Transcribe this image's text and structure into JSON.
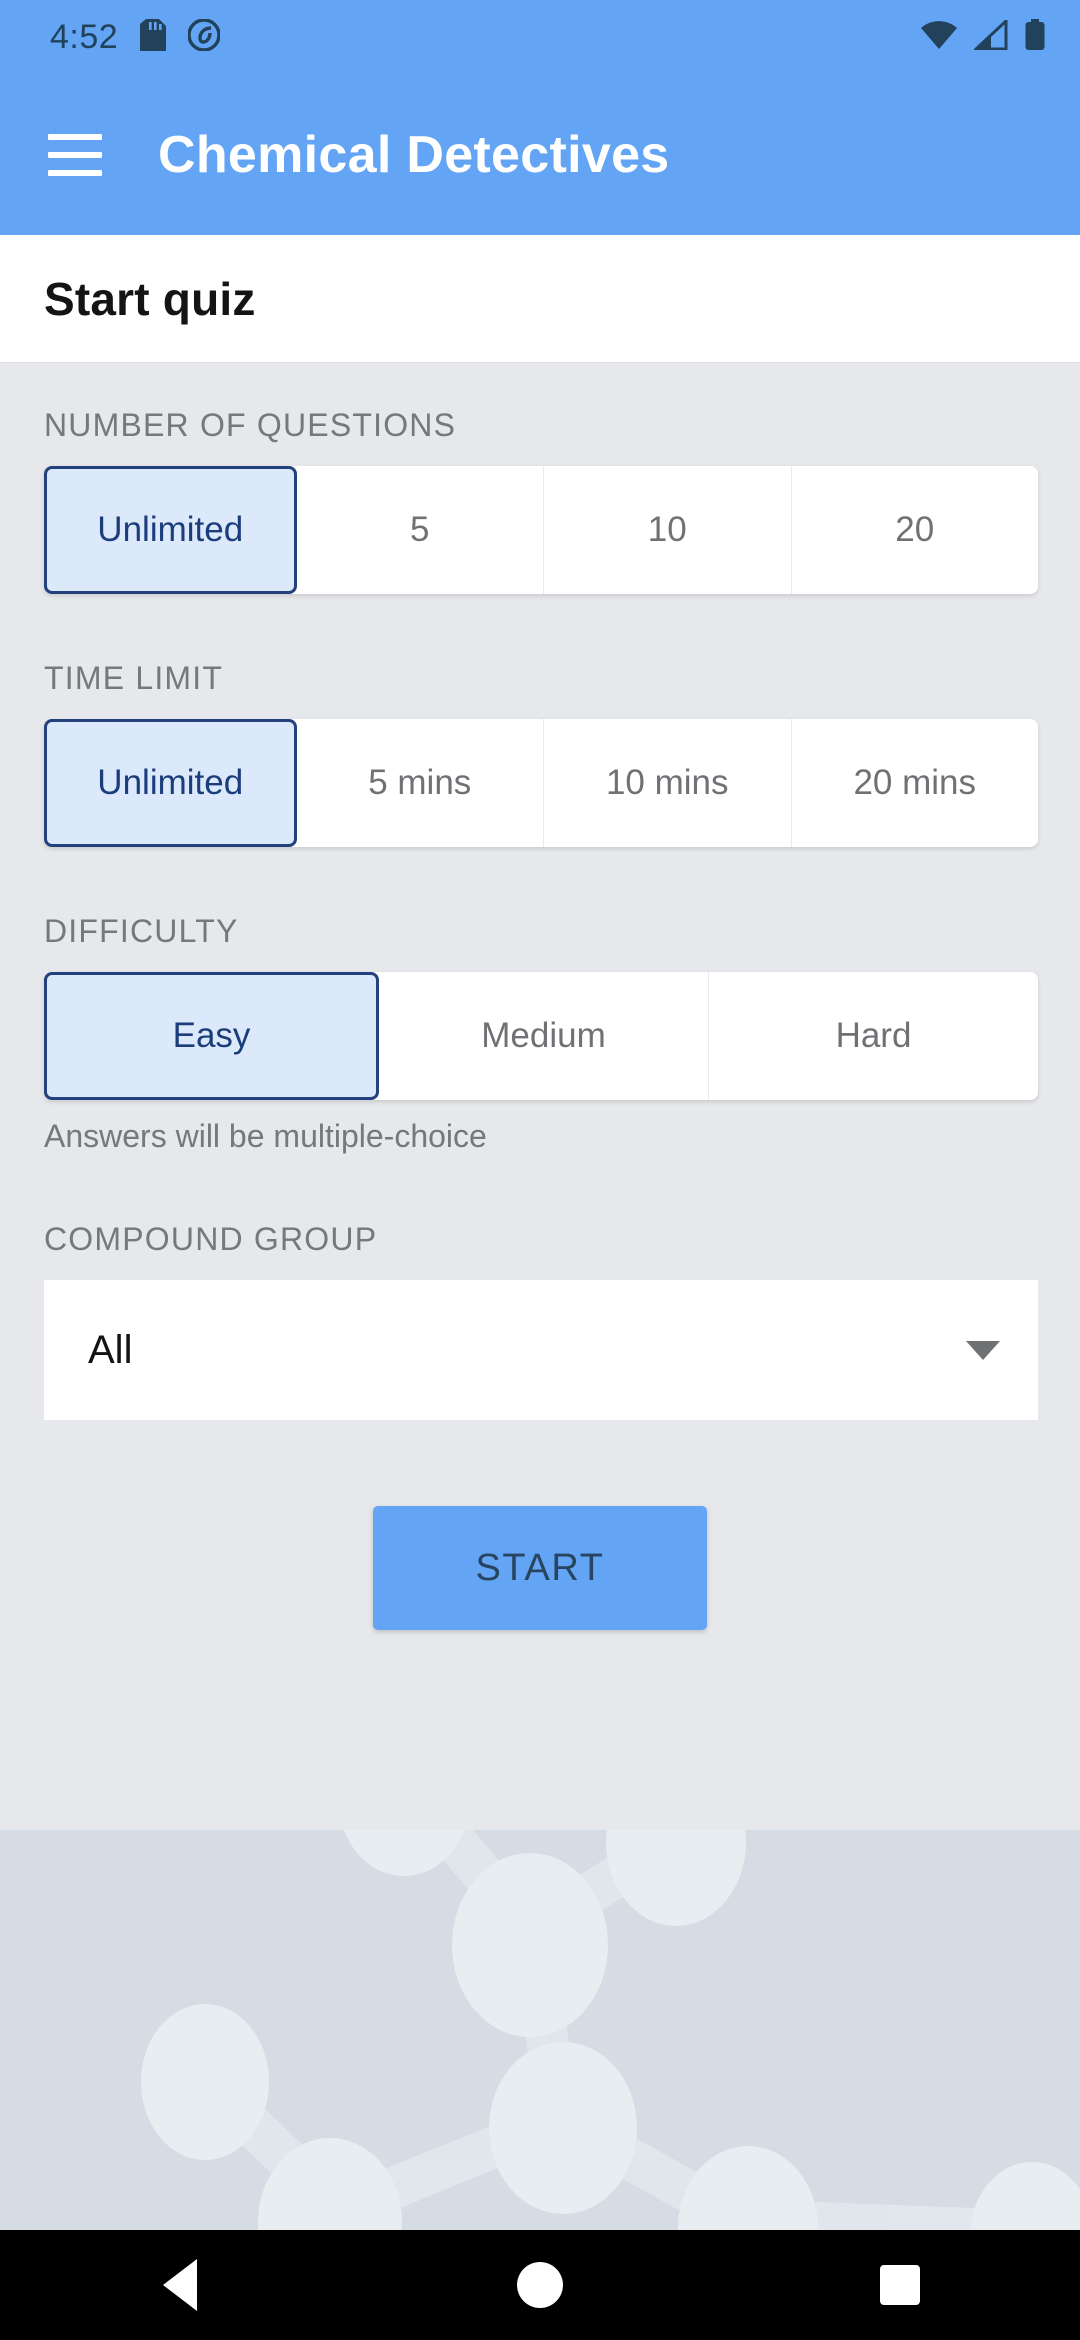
{
  "status_bar": {
    "time": "4:52",
    "icons": [
      "sd-card-icon",
      "screenshot-capture-icon",
      "wifi-icon",
      "cellular-signal-icon",
      "battery-icon"
    ]
  },
  "app_bar": {
    "menu_icon": "hamburger-menu-icon",
    "title": "Chemical Detectives"
  },
  "page": {
    "title": "Start quiz"
  },
  "sections": {
    "number_of_questions": {
      "label": "NUMBER OF QUESTIONS",
      "options": [
        "Unlimited",
        "5",
        "10",
        "20"
      ],
      "selected": "Unlimited"
    },
    "time_limit": {
      "label": "TIME LIMIT",
      "options": [
        "Unlimited",
        "5 mins",
        "10 mins",
        "20 mins"
      ],
      "selected": "Unlimited"
    },
    "difficulty": {
      "label": "DIFFICULTY",
      "options": [
        "Easy",
        "Medium",
        "Hard"
      ],
      "selected": "Easy",
      "helper_text": "Answers will be multiple-choice"
    },
    "compound_group": {
      "label": "COMPOUND GROUP",
      "selected": "All",
      "caret_icon": "chevron-down-icon"
    }
  },
  "actions": {
    "start_label": "START"
  },
  "nav_bar": {
    "back": "back-triangle-icon",
    "home": "home-circle-icon",
    "recents": "recents-square-icon"
  },
  "colors": {
    "accent_blue": "#63a4f5",
    "selected_fill": "#dbe9fb",
    "selected_border": "#23417c",
    "selected_text": "#1b3d7a",
    "body_bg": "#e6e8eb",
    "molecule_bg": "#d5dce4",
    "label_gray": "#76787b"
  }
}
